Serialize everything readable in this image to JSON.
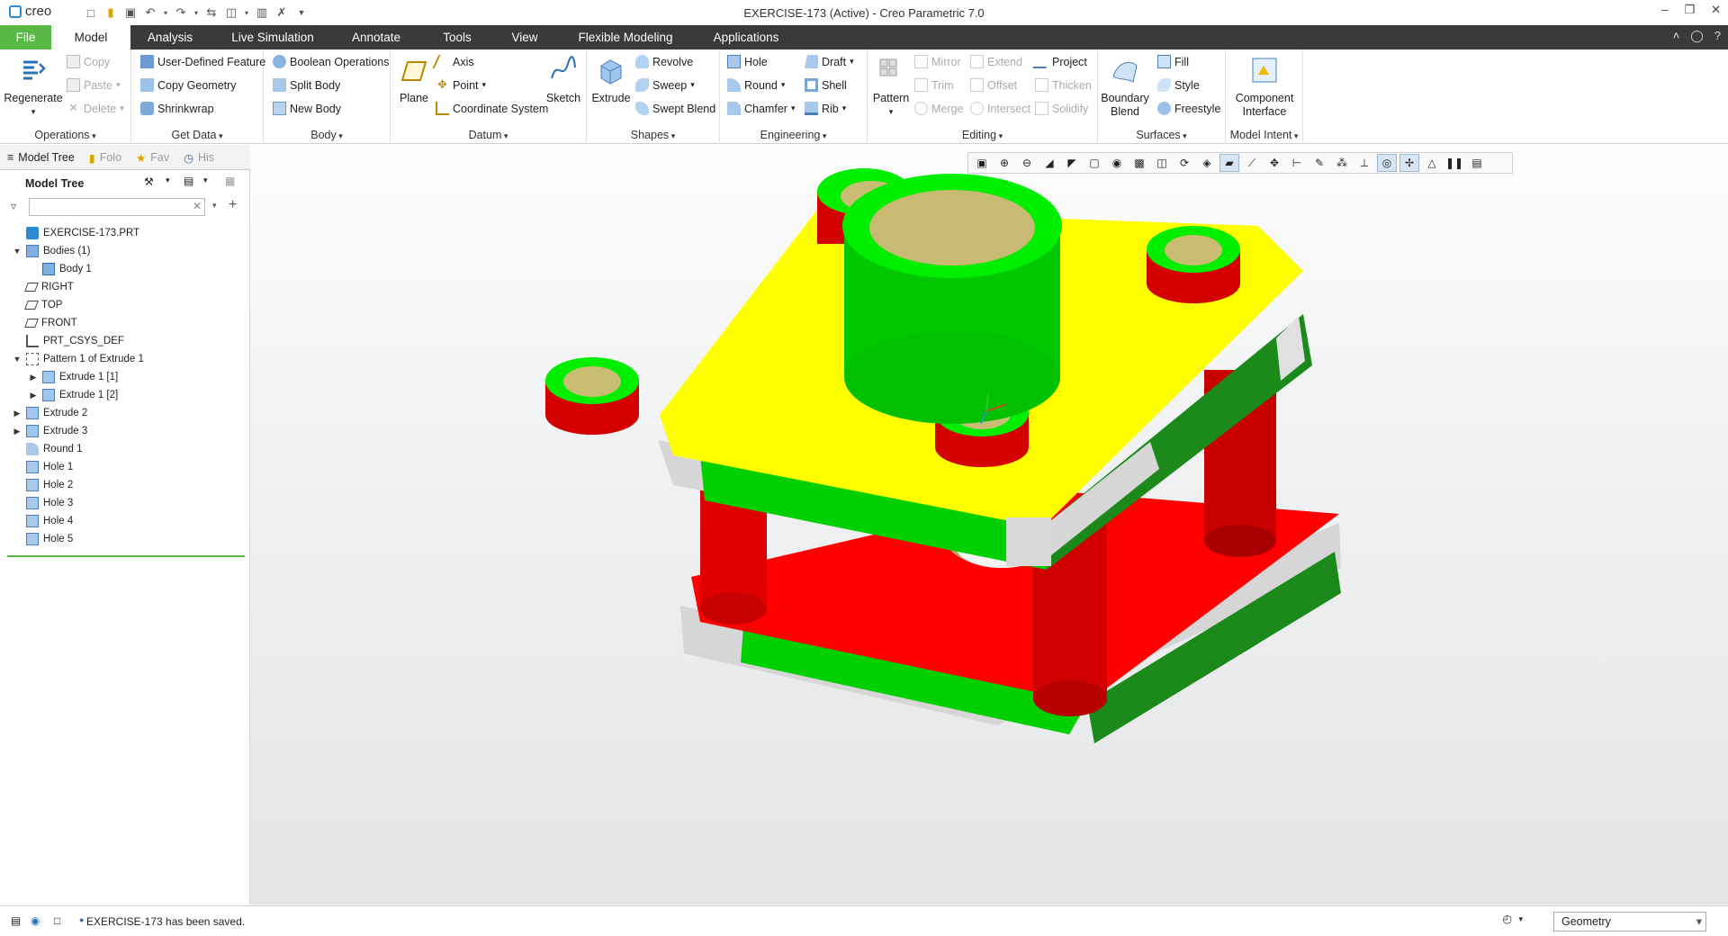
{
  "app": {
    "logo_text": "creo",
    "window_title": "EXERCISE-173 (Active) - Creo Parametric 7.0"
  },
  "menu": {
    "tabs": [
      "File",
      "Model",
      "Analysis",
      "Live Simulation",
      "Annotate",
      "Tools",
      "View",
      "Flexible Modeling",
      "Applications"
    ],
    "active": "Model"
  },
  "ribbon": {
    "operations": {
      "caption": "Operations",
      "regenerate": "Regenerate",
      "copy": "Copy",
      "paste": "Paste",
      "delete": "Delete"
    },
    "get_data": {
      "caption": "Get Data",
      "udf": "User-Defined Feature",
      "copy_geometry": "Copy Geometry",
      "shrinkwrap": "Shrinkwrap"
    },
    "body": {
      "caption": "Body",
      "boolean": "Boolean Operations",
      "split": "Split Body",
      "new_body": "New Body"
    },
    "datum": {
      "caption": "Datum",
      "plane": "Plane",
      "axis": "Axis",
      "point": "Point",
      "csys": "Coordinate System",
      "sketch": "Sketch"
    },
    "shapes": {
      "caption": "Shapes",
      "extrude": "Extrude",
      "revolve": "Revolve",
      "sweep": "Sweep",
      "swept_blend": "Swept Blend"
    },
    "engineering": {
      "caption": "Engineering",
      "hole": "Hole",
      "round": "Round",
      "chamfer": "Chamfer",
      "draft": "Draft",
      "shell": "Shell",
      "rib": "Rib"
    },
    "editing": {
      "caption": "Editing",
      "pattern": "Pattern",
      "mirror": "Mirror",
      "trim": "Trim",
      "merge": "Merge",
      "extend": "Extend",
      "offset": "Offset",
      "intersect": "Intersect",
      "project": "Project",
      "thicken": "Thicken",
      "solidify": "Solidify"
    },
    "surfaces": {
      "caption": "Surfaces",
      "boundary_blend": "Boundary Blend",
      "fill": "Fill",
      "style": "Style",
      "freestyle": "Freestyle"
    },
    "model_intent": {
      "caption": "Model Intent",
      "component_interface": "Component Interface"
    }
  },
  "panel": {
    "tabs": [
      "Model Tree",
      "Folder Browser",
      "Favorites",
      "History"
    ],
    "tab_visible": [
      "Model Tree",
      "Folo",
      "Fav",
      "His"
    ],
    "tree_title": "Model Tree",
    "search_value": "",
    "items": [
      {
        "label": "EXERCISE-173.PRT",
        "level": 0,
        "expander": "",
        "icon": "part-icon"
      },
      {
        "label": "Bodies (1)",
        "level": 0,
        "expander": "open",
        "icon": "bodies-icon"
      },
      {
        "label": "Body 1",
        "level": 1,
        "expander": "",
        "icon": "body-icon"
      },
      {
        "label": "RIGHT",
        "level": 0,
        "expander": "",
        "icon": "datum-plane-icon"
      },
      {
        "label": "TOP",
        "level": 0,
        "expander": "",
        "icon": "datum-plane-icon"
      },
      {
        "label": "FRONT",
        "level": 0,
        "expander": "",
        "icon": "datum-plane-icon"
      },
      {
        "label": "PRT_CSYS_DEF",
        "level": 0,
        "expander": "",
        "icon": "csys-icon"
      },
      {
        "label": "Pattern 1 of Extrude 1",
        "level": 0,
        "expander": "open",
        "icon": "pattern-icon"
      },
      {
        "label": "Extrude 1 [1]",
        "level": 1,
        "expander": "closed",
        "icon": "extrude-icon"
      },
      {
        "label": "Extrude 1 [2]",
        "level": 1,
        "expander": "closed",
        "icon": "extrude-icon"
      },
      {
        "label": "Extrude 2",
        "level": 0,
        "expander": "closed",
        "icon": "extrude-icon"
      },
      {
        "label": "Extrude 3",
        "level": 0,
        "expander": "closed",
        "icon": "extrude-icon"
      },
      {
        "label": "Round 1",
        "level": 0,
        "expander": "",
        "icon": "round-icon"
      },
      {
        "label": "Hole 1",
        "level": 0,
        "expander": "",
        "icon": "hole-icon"
      },
      {
        "label": "Hole 2",
        "level": 0,
        "expander": "",
        "icon": "hole-icon"
      },
      {
        "label": "Hole 3",
        "level": 0,
        "expander": "",
        "icon": "hole-icon"
      },
      {
        "label": "Hole 4",
        "level": 0,
        "expander": "",
        "icon": "hole-icon"
      },
      {
        "label": "Hole 5",
        "level": 0,
        "expander": "",
        "icon": "hole-icon"
      }
    ]
  },
  "status": {
    "message": "EXERCISE-173 has been saved.",
    "filter": "Geometry"
  },
  "colors": {
    "accent_green": "#58b947",
    "menubar": "#3a3a3a",
    "model_yellow": "#ffff00",
    "model_green": "#00dd00",
    "model_red": "#ff0000"
  }
}
